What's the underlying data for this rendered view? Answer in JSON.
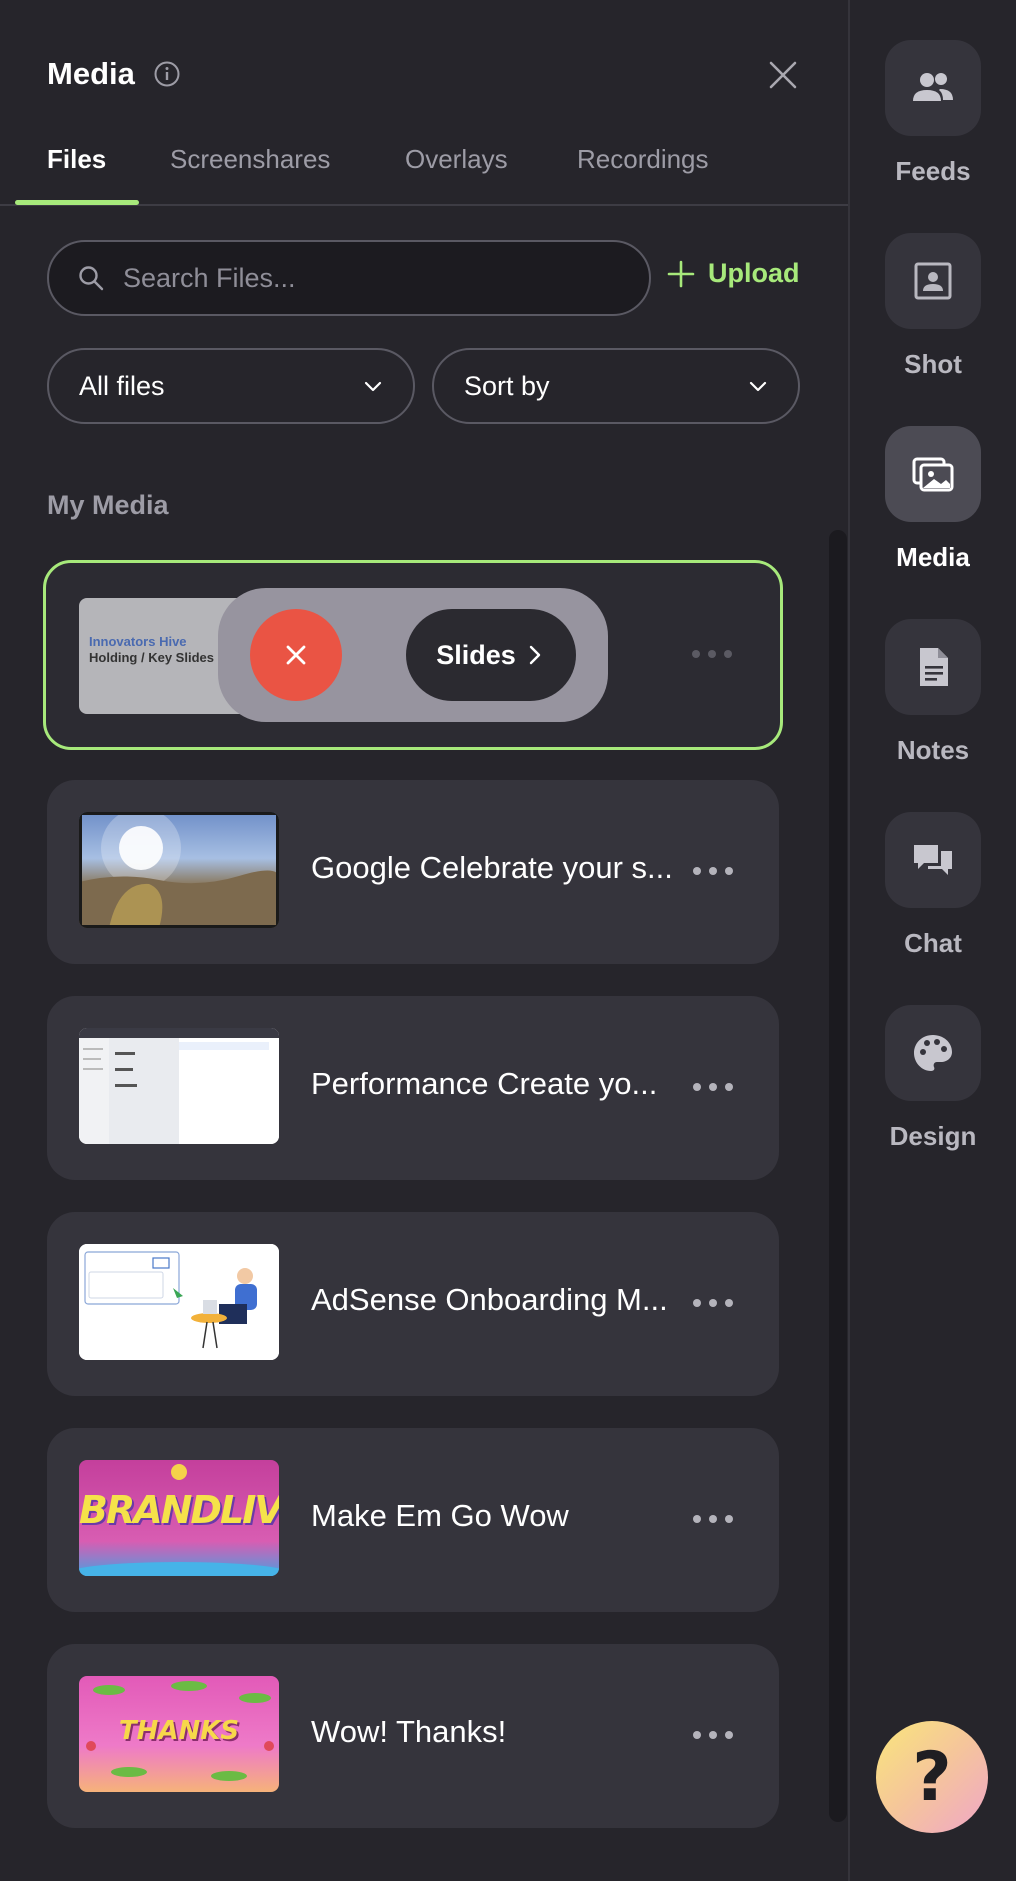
{
  "header": {
    "title": "Media"
  },
  "tabs": [
    {
      "label": "Files"
    },
    {
      "label": "Screenshares"
    },
    {
      "label": "Overlays"
    },
    {
      "label": "Recordings"
    }
  ],
  "search": {
    "placeholder": "Search Files...",
    "value": ""
  },
  "upload": {
    "label": "Upload"
  },
  "filters": {
    "type_value": "All files",
    "sort_value": "Sort by"
  },
  "section": {
    "title": "My Media"
  },
  "selected_item": {
    "thumb_line1": "Innovators Hive",
    "thumb_line2": "Holding / Key Slides",
    "action_label": "Slides"
  },
  "items": [
    {
      "name": "Google Celebrate your s..."
    },
    {
      "name": "Performance Create yo..."
    },
    {
      "name": "AdSense Onboarding M..."
    },
    {
      "name": "Make Em Go Wow"
    },
    {
      "name": "Wow! Thanks!"
    }
  ],
  "thumb_text": {
    "brandlive": "BRANDLIVE",
    "thanks": "THANKS"
  },
  "rail": [
    {
      "label": "Feeds",
      "icon": "people-icon"
    },
    {
      "label": "Shot",
      "icon": "shot-icon"
    },
    {
      "label": "Media",
      "icon": "image-icon"
    },
    {
      "label": "Notes",
      "icon": "document-icon"
    },
    {
      "label": "Chat",
      "icon": "chat-icon"
    },
    {
      "label": "Design",
      "icon": "palette-icon"
    }
  ],
  "help": {
    "label": "?"
  },
  "colors": {
    "accent": "#a7e97b",
    "danger": "#ea5444",
    "background": "#26252b",
    "card": "#35343c"
  }
}
